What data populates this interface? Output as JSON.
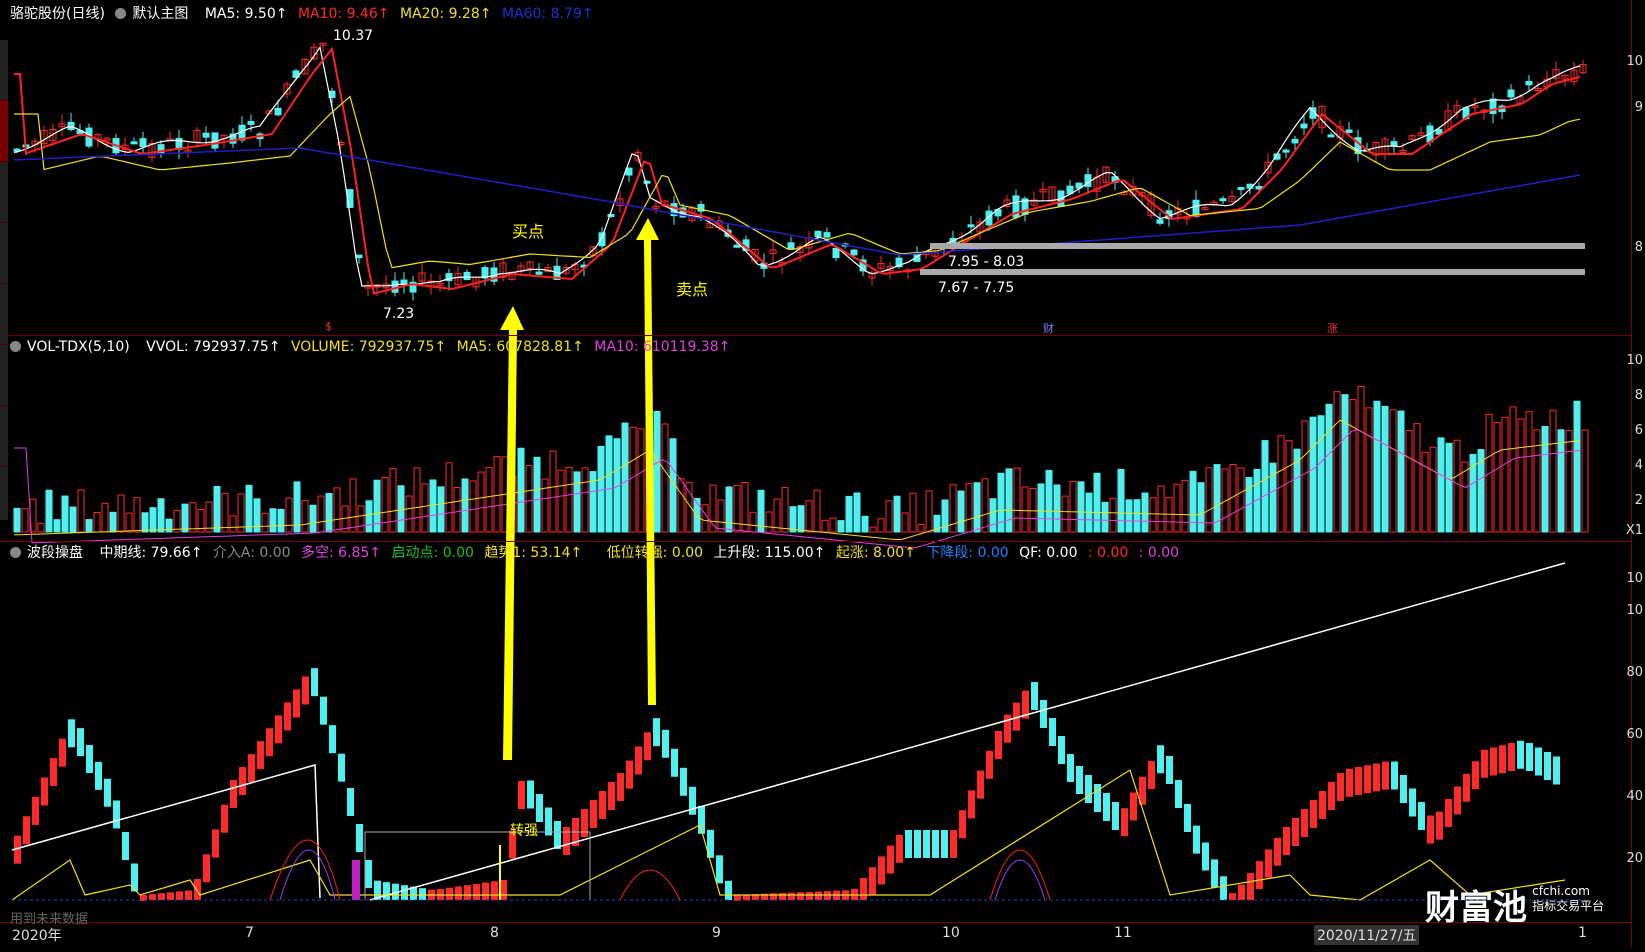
{
  "main_header": {
    "title": "骆驼股份(日线)",
    "chart_label": "默认主图",
    "ma5": "MA5: 9.50↑",
    "ma10": "MA10: 9.46↑",
    "ma20": "MA20: 9.28↑",
    "ma60": "MA60: 8.79↑"
  },
  "vol_header": {
    "name": "VOL-TDX(5,10)",
    "vvol": "VVOL: 792937.75↑",
    "volume": "VOLUME: 792937.75↑",
    "ma5": "MA5: 607828.81↑",
    "ma10": "MA10: 610119.38↑"
  },
  "ind_header": {
    "name": "波段操盘",
    "mid": "中期线: 79.66↑",
    "jieru": "介入A: 0.00",
    "duokong": "多空: 6.85↑",
    "qidong": "启动点: 0.00",
    "qushi": "趋势1: 53.14↑",
    "diwei": "低位转强: 0.00",
    "shangsheng": "上升段: 115.00↑",
    "qizhang": "起涨: 8.00↑",
    "xiajiang": "下降段: 0.00",
    "qf": "QF: 0.00",
    "z1": ": 0.00",
    "z2": ": 0.00"
  },
  "price_labels": {
    "high": "10.37",
    "low": "7.23",
    "band1": "7.95 - 8.03",
    "band2": "7.67 - 7.75"
  },
  "annotations": {
    "buy": "买点",
    "sell": "卖点",
    "turn": "转强"
  },
  "markers": {
    "m1": "$",
    "m2": "财",
    "m3": "涨"
  },
  "x_axis": [
    "2020年",
    "7",
    "8",
    "9",
    "10",
    "11",
    "2020/11/27/五",
    "1"
  ],
  "y_axis_price": [
    "10",
    "9",
    "8"
  ],
  "y_axis_vol": [
    "10",
    "8",
    "6",
    "4",
    "2",
    "X1"
  ],
  "y_axis_ind": [
    "10",
    "10",
    "80",
    "60",
    "40",
    "20"
  ],
  "bottom_text": "用到未来数据",
  "logo": {
    "main": "财富池",
    "url": "cfchi.com",
    "sub": "指标交易平台"
  },
  "colors": {
    "up": "#ff2a2a",
    "down": "#4ff0f0",
    "ma5": "#ffffff",
    "ma10": "#ff2020",
    "ma20": "#f0e020",
    "ma60": "#2020c0",
    "arrow": "#ffff00"
  }
}
